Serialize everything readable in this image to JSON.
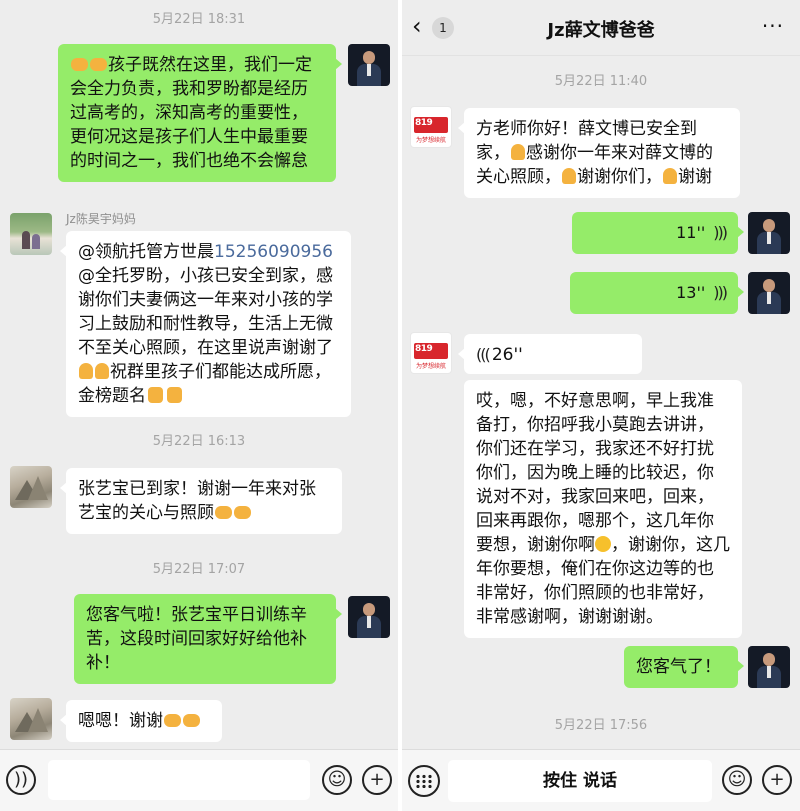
{
  "left": {
    "timestamps": [
      "5月22日 18:31",
      "5月22日 16:13",
      "5月22日 17:07"
    ],
    "messages": {
      "m1": "孩子既然在这里，我们一定会全力负责，我和罗盼都是经历过高考的，深知高考的重要性，更何况这是孩子们人生中最重要的时间之一，我们也绝不会懈怠",
      "m2_sender": "Jz陈昊宇妈妈",
      "m2_prefix": "@领航托管方世晨",
      "m2_phone": "15256090956",
      "m2_body": " @全托罗盼，小孩已安全到家，感谢你们夫妻俩这一年来对小孩的学习上鼓励和耐性教导，生活上无微不至关心照顾，在这里说声谢谢了",
      "m2_tail": "祝群里孩子们都能达成所愿，金榜题名",
      "m3": "张艺宝已到家！谢谢一年来对张艺宝的关心与照顾",
      "m4": "您客气啦！张艺宝平日训练辛苦，这段时间回家好好给他补补！",
      "m5": "嗯嗯！谢谢"
    },
    "input_icons": [
      "voice-icon",
      "emoji-icon",
      "plus-icon"
    ]
  },
  "right": {
    "header": {
      "back_count": "1",
      "title": "Jz薛文博爸爸",
      "more": "···"
    },
    "timestamps": [
      "5月22日 11:40",
      "5月22日 17:56"
    ],
    "messages": {
      "r1_a": "方老师你好！薛文博已安全到家，",
      "r1_b": "感谢你一年来对薛文博的关心照顾，",
      "r1_c": "谢谢你们，",
      "r1_d": "谢谢",
      "v1": "11''",
      "v2": "13''",
      "v3": "26''",
      "r2_a": "哎，嗯，不好意思啊，早上我准备打，你招呼我小莫跑去讲讲，你们还在学习，我家还不好打扰你们，因为晚上睡的比较迟，你说对不对，我家回来吧，回来，回来再跟你，嗯那个，这几年你要想，",
      "r2_b": "，谢谢你，这几年你要想，俺们在你这边等的也非常好，你们照顾的也非常好，非常感谢啊，谢谢谢谢。",
      "r2_c": "谢谢你啊",
      "r3": "您客气了！"
    },
    "hold_to_talk": "按住 说话",
    "avatar_red_text": "819",
    "avatar_red_sub": "为梦想续航"
  }
}
